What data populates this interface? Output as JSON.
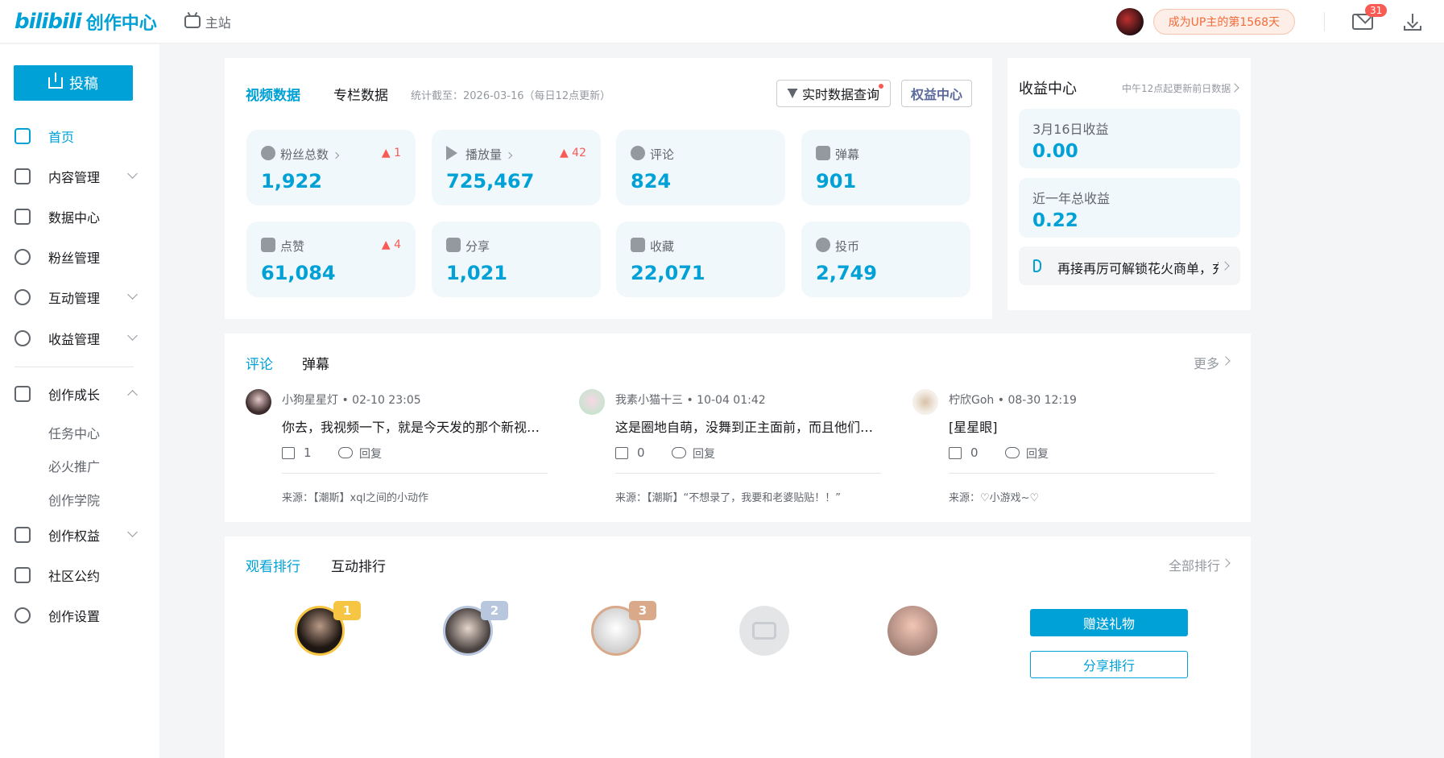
{
  "header": {
    "logo_bili": "bilibili",
    "logo_text": "创作中心",
    "home_label": "主站",
    "up_days": "成为UP主的第1568天",
    "mail_badge": "31"
  },
  "sidebar": {
    "upload_label": "投稿",
    "items": [
      {
        "label": "首页"
      },
      {
        "label": "内容管理"
      },
      {
        "label": "数据中心"
      },
      {
        "label": "粉丝管理"
      },
      {
        "label": "互动管理"
      },
      {
        "label": "收益管理"
      },
      {
        "label": "创作成长"
      },
      {
        "label": "创作权益"
      },
      {
        "label": "社区公约"
      },
      {
        "label": "创作设置"
      }
    ],
    "growth_sub": [
      "任务中心",
      "必火推广",
      "创作学院"
    ]
  },
  "overview": {
    "tabs": [
      "视频数据",
      "专栏数据"
    ],
    "stat_note": "统计截至：2026-03-16（每日12点更新）",
    "realtime_btn": "实时数据查询",
    "rights_btn": "权益中心",
    "metrics": [
      {
        "label": "粉丝总数",
        "value": "1,922",
        "delta": "1",
        "icon": "fans-icon"
      },
      {
        "label": "播放量",
        "value": "725,467",
        "delta": "42",
        "icon": "play-icon"
      },
      {
        "label": "评论",
        "value": "824",
        "delta": "",
        "icon": "comment-icon"
      },
      {
        "label": "弹幕",
        "value": "901",
        "delta": "",
        "icon": "danmaku-icon"
      },
      {
        "label": "点赞",
        "value": "61,084",
        "delta": "4",
        "icon": "like-icon"
      },
      {
        "label": "分享",
        "value": "1,021",
        "delta": "",
        "icon": "share-icon"
      },
      {
        "label": "收藏",
        "value": "22,071",
        "delta": "",
        "icon": "star-icon"
      },
      {
        "label": "投币",
        "value": "2,749",
        "delta": "",
        "icon": "coin-icon"
      }
    ]
  },
  "earnings": {
    "title": "收益中心",
    "note": "中午12点起更新前日数据",
    "boxes": [
      {
        "label": "3月16日收益",
        "value": "0.00"
      },
      {
        "label": "近一年总收益",
        "value": "0.22"
      }
    ],
    "notice": "再接再厉可解锁花火商单，充"
  },
  "comments": {
    "tabs": [
      "评论",
      "弹幕"
    ],
    "more": "更多",
    "items": [
      {
        "name": "小狗星星灯",
        "time": "02-10 23:05",
        "text": "你去，我视频一下，就是今天发的那个新视频…",
        "likes": "1",
        "reply": "回复",
        "source": "来源：【潮斯】xql之间的小动作"
      },
      {
        "name": "我素小猫十三",
        "time": "10-04 01:42",
        "text": "这是圈地自萌，没舞到正主面前，而且他们也…",
        "likes": "0",
        "reply": "回复",
        "source": "来源：【潮斯】“不想录了，我要和老婆贴贴！！”"
      },
      {
        "name": "柠欣Goh",
        "time": "08-30 12:19",
        "text": "[星星眼]",
        "likes": "0",
        "reply": "回复",
        "source": "来源：♡小游戏~♡"
      }
    ]
  },
  "ranking": {
    "tabs": [
      "观看排行",
      "互动排行"
    ],
    "more": "全部排行",
    "badges": [
      "1",
      "2",
      "3"
    ],
    "gift_btn": "赠送礼物",
    "share_btn": "分享排行"
  },
  "colors": {
    "accent": "#00a1d6",
    "delta_red": "#f85a54",
    "card_bg": "#f1f8fc",
    "gold": "#f6c544",
    "silver": "#b8c6de",
    "bronze": "#d9a98a"
  }
}
